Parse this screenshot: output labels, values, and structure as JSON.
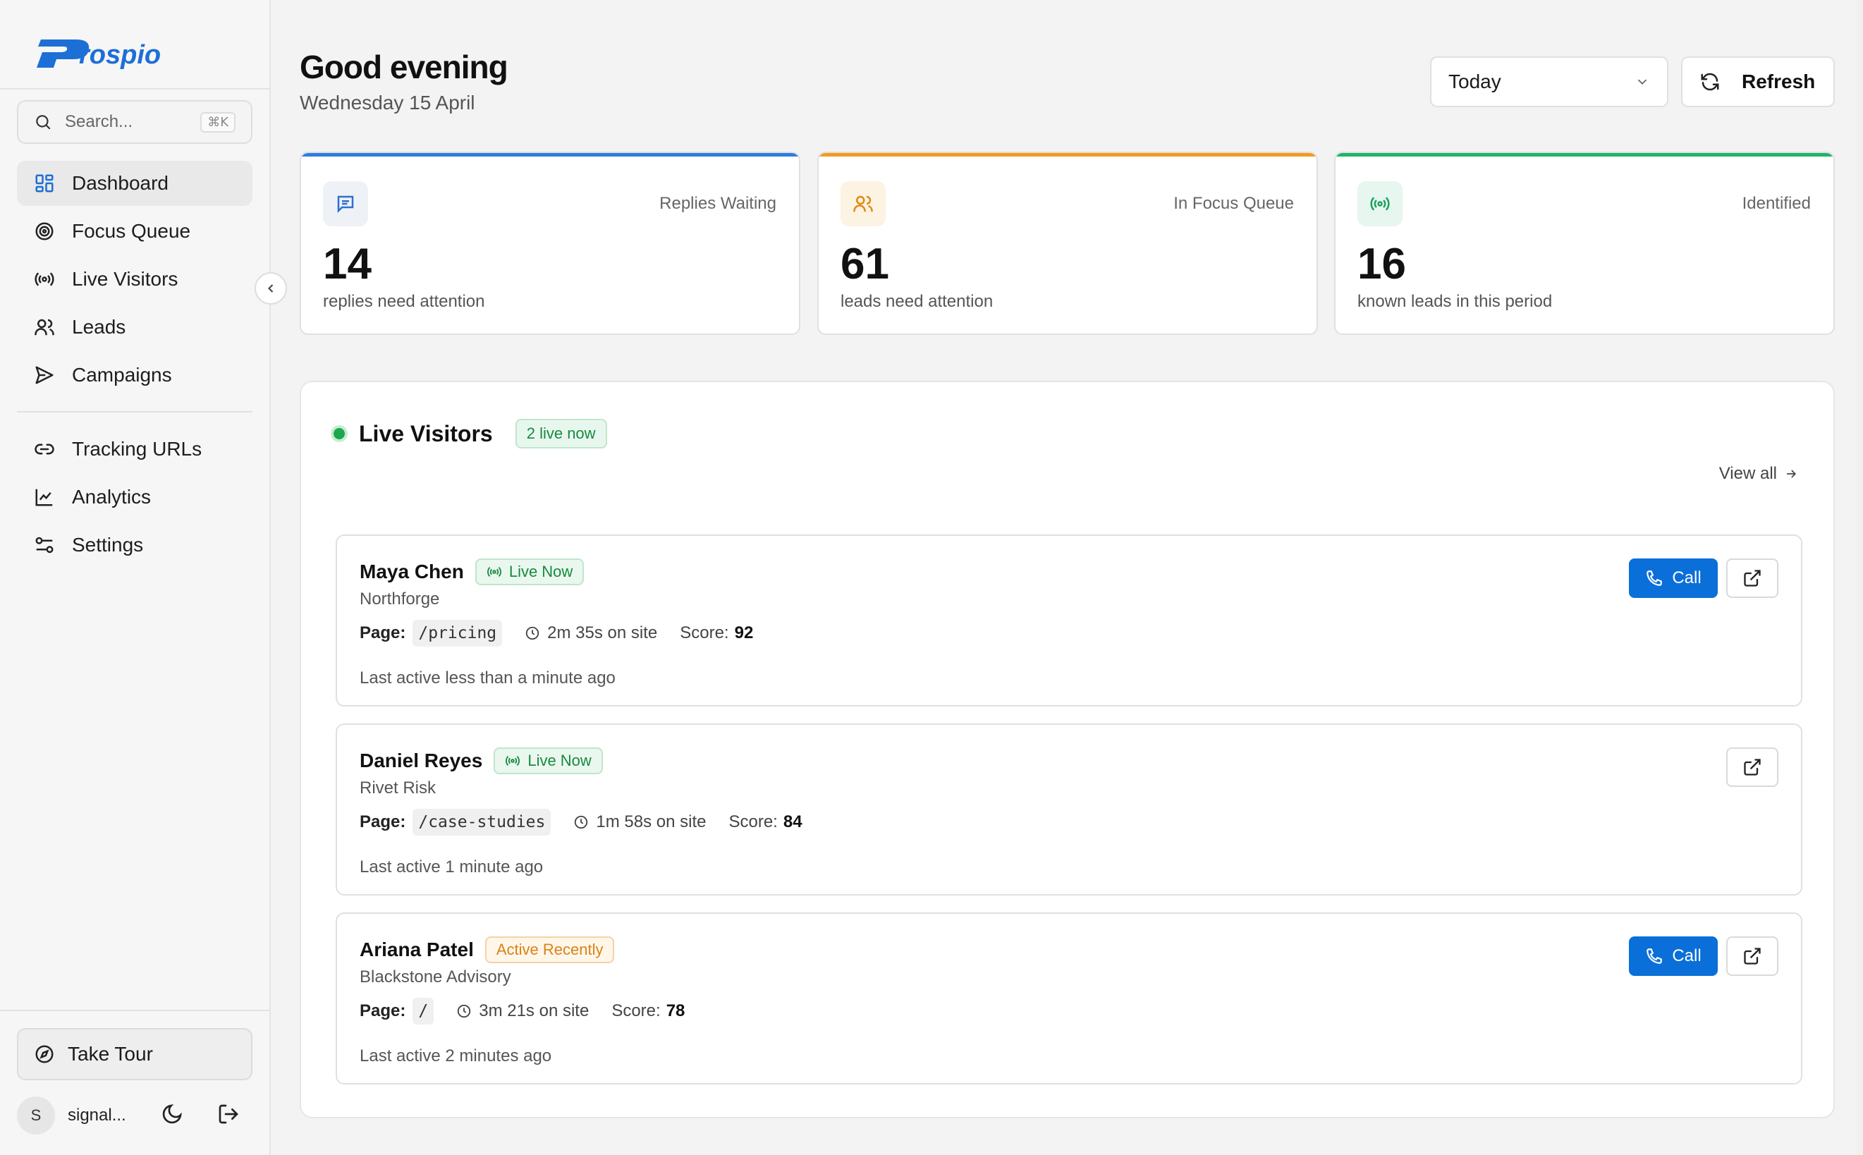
{
  "brand": {
    "name": "Prospio",
    "accent": "#1d6fd6"
  },
  "sidebar": {
    "search": {
      "placeholder": "Search...",
      "shortcut": "⌘K"
    },
    "primary_items": [
      {
        "label": "Dashboard",
        "icon": "grid-icon",
        "active": true
      },
      {
        "label": "Focus Queue",
        "icon": "target-icon"
      },
      {
        "label": "Live Visitors",
        "icon": "broadcast-icon"
      },
      {
        "label": "Leads",
        "icon": "users-icon"
      },
      {
        "label": "Campaigns",
        "icon": "send-icon"
      }
    ],
    "secondary_items": [
      {
        "label": "Tracking URLs",
        "icon": "link-icon"
      },
      {
        "label": "Analytics",
        "icon": "line-chart-icon"
      },
      {
        "label": "Settings",
        "icon": "sliders-icon"
      }
    ],
    "tour_label": "Take Tour",
    "user": {
      "initial": "S",
      "name": "signal..."
    }
  },
  "header": {
    "greeting": "Good evening",
    "date": "Wednesday 15 April",
    "period": "Today",
    "refresh_label": "Refresh"
  },
  "stats": [
    {
      "label": "Replies Waiting",
      "value": "14",
      "caption": "replies need attention",
      "color": "#2f7de0",
      "icon": "message-icon"
    },
    {
      "label": "In Focus Queue",
      "value": "61",
      "caption": "leads need attention",
      "color": "#f29a21",
      "icon": "users-icon"
    },
    {
      "label": "Identified",
      "value": "16",
      "caption": "known leads in this period",
      "color": "#1fb46a",
      "icon": "broadcast-icon"
    }
  ],
  "live_visitors": {
    "title": "Live Visitors",
    "live_count": "2 live now",
    "view_all": "View all",
    "labels": {
      "page": "Page:",
      "score": "Score:",
      "call": "Call"
    },
    "visitors": [
      {
        "name": "Maya Chen",
        "status": "Live Now",
        "status_type": "live",
        "company": "Northforge",
        "page": "/pricing",
        "time": "2m 35s on site",
        "score": "92",
        "last_active": "Last active less than a minute ago",
        "can_call": true
      },
      {
        "name": "Daniel Reyes",
        "status": "Live Now",
        "status_type": "live",
        "company": "Rivet Risk",
        "page": "/case-studies",
        "time": "1m 58s on site",
        "score": "84",
        "last_active": "Last active 1 minute ago",
        "can_call": false
      },
      {
        "name": "Ariana Patel",
        "status": "Active Recently",
        "status_type": "recent",
        "company": "Blackstone Advisory",
        "page": "/",
        "time": "3m 21s on site",
        "score": "78",
        "last_active": "Last active 2 minutes ago",
        "can_call": true
      }
    ]
  }
}
